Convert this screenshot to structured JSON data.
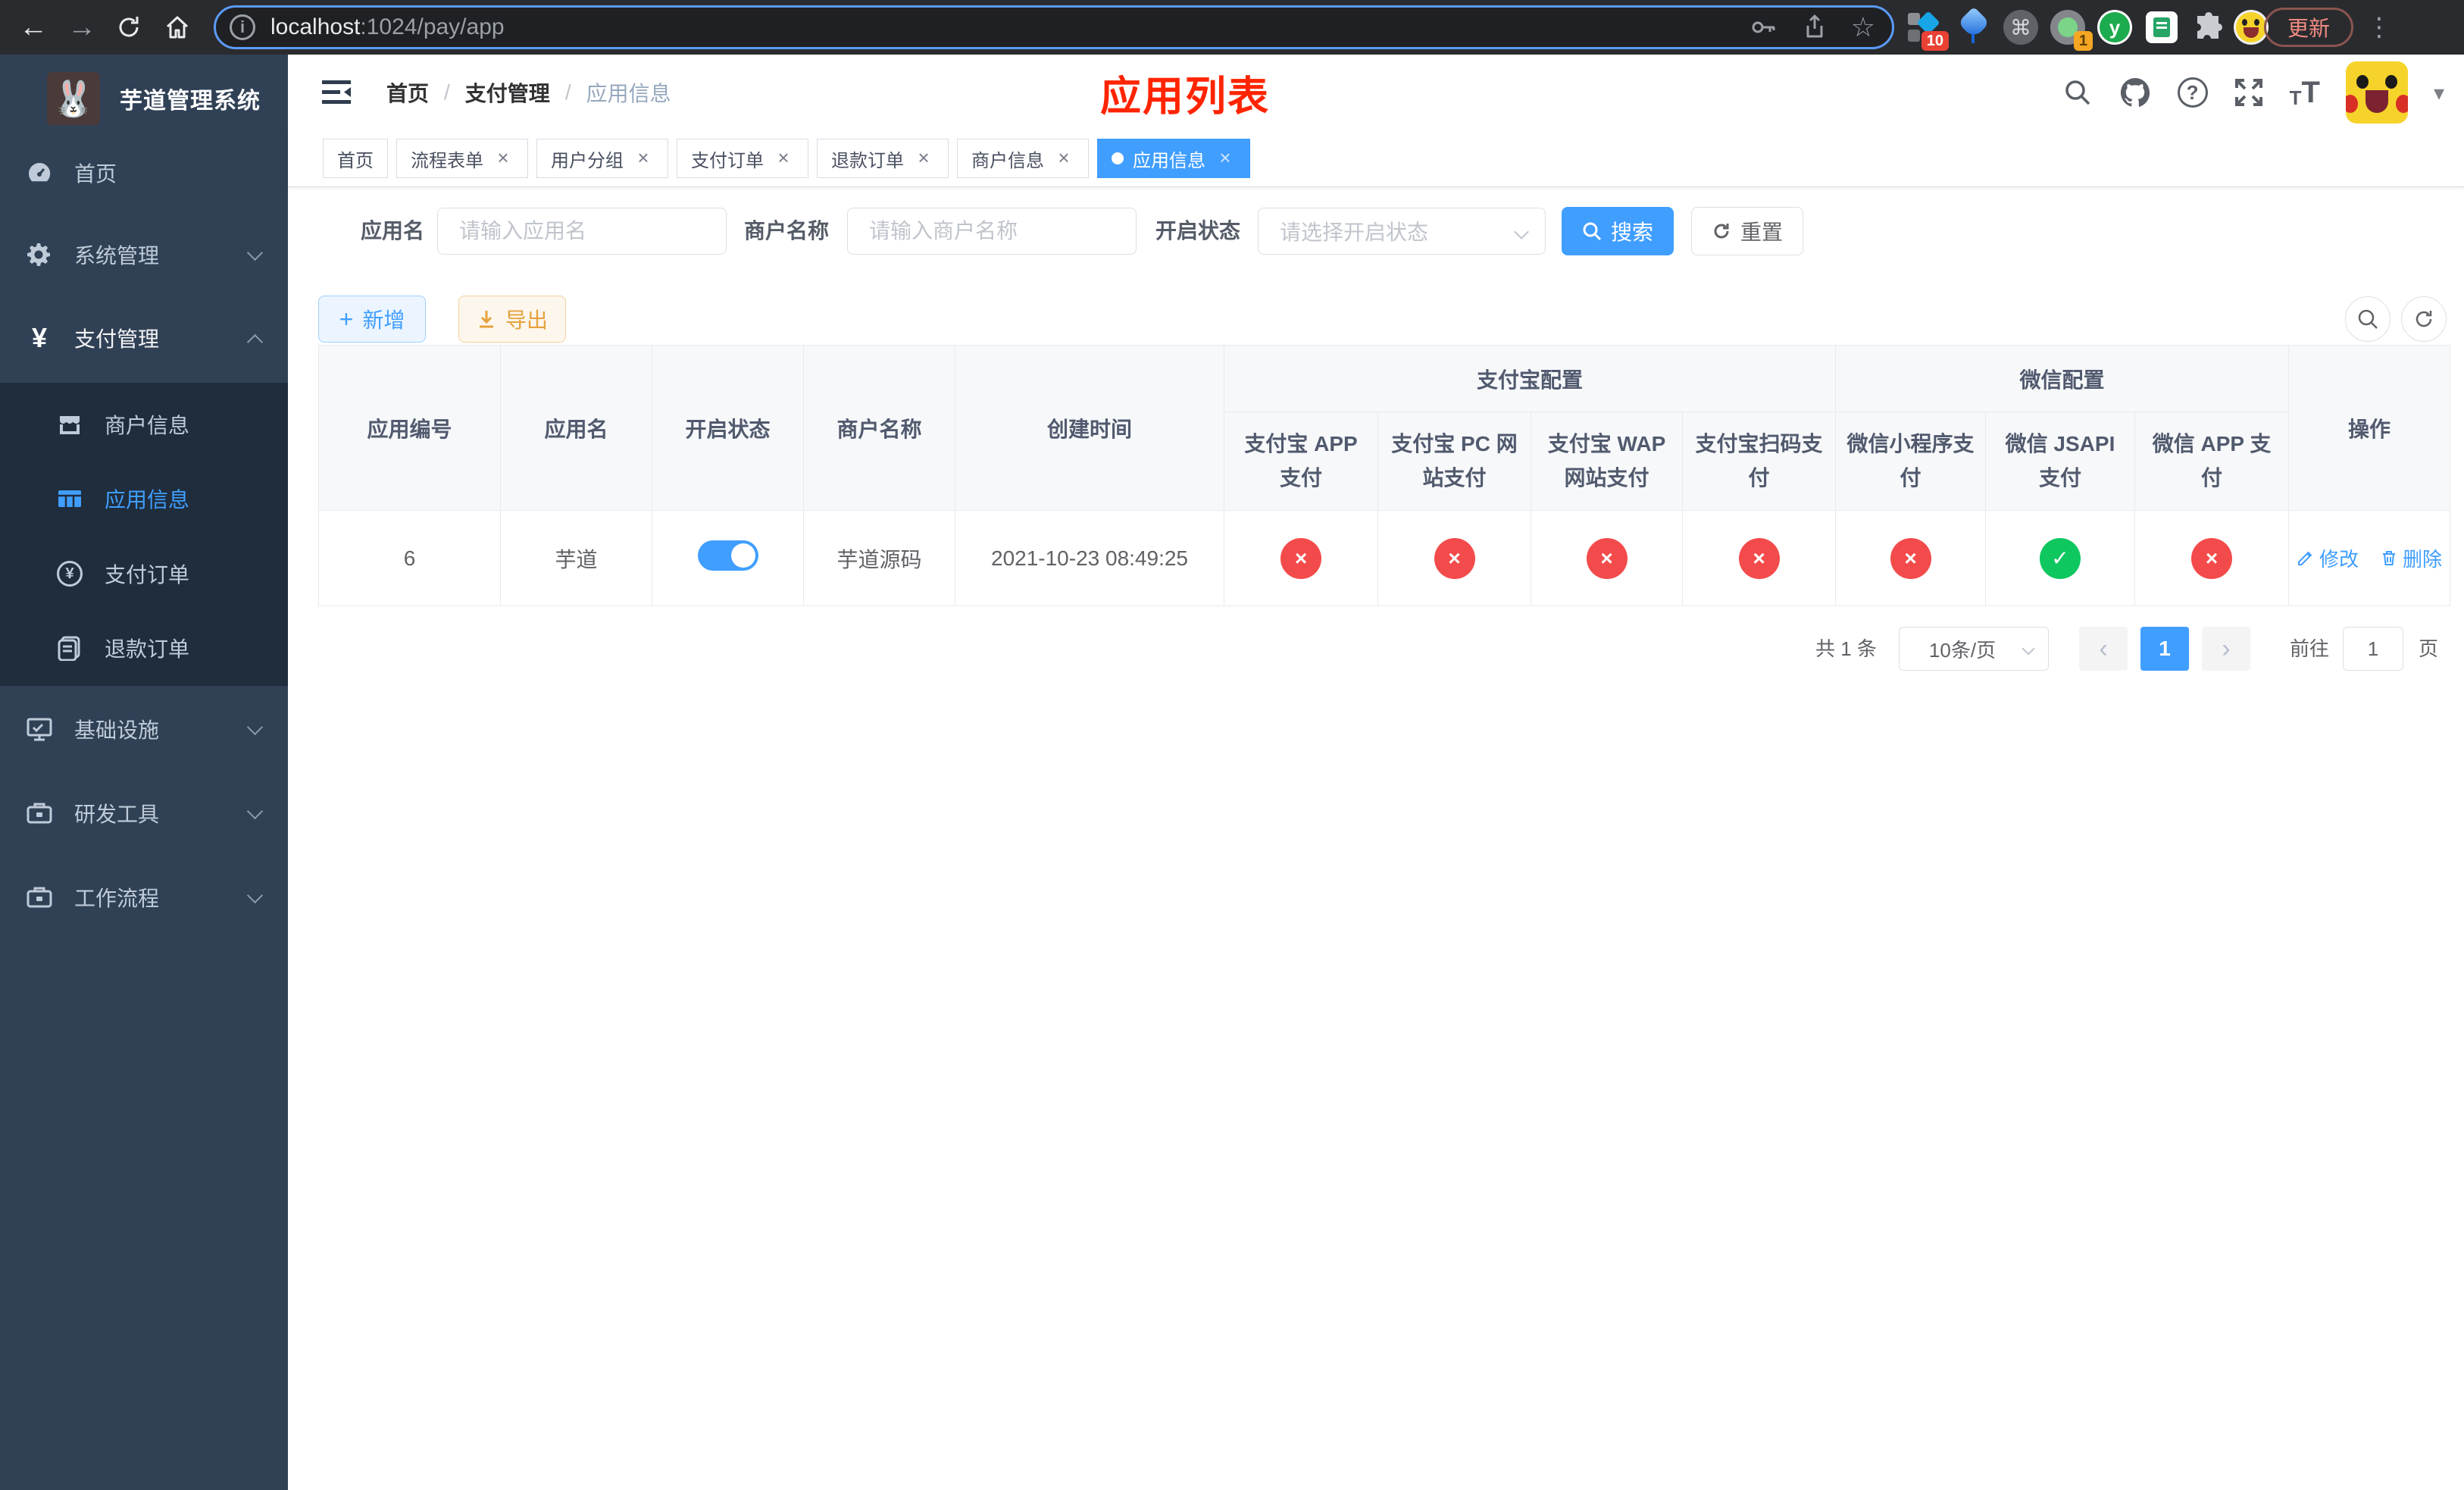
{
  "browser": {
    "url_host": "localhost",
    "url_path": ":1024/pay/app",
    "info_glyph": "i",
    "star_glyph": "☆",
    "back_glyph": "←",
    "forward_glyph": "→",
    "kebab_glyph": "⋮",
    "update_label": "更新",
    "ext_badge_10": "10",
    "ext_badge_1": "1",
    "ext_cmd_glyph": "⌘",
    "ext_y_glyph": "y"
  },
  "sidebar": {
    "title": "芋道管理系统",
    "logo_glyph": "🐰",
    "menu": [
      {
        "label": "首页"
      },
      {
        "label": "系统管理"
      },
      {
        "label": "支付管理"
      },
      {
        "label": "基础设施"
      },
      {
        "label": "研发工具"
      },
      {
        "label": "工作流程"
      }
    ],
    "submenu": [
      {
        "label": "商户信息"
      },
      {
        "label": "应用信息"
      },
      {
        "label": "支付订单"
      },
      {
        "label": "退款订单"
      }
    ],
    "pay_order_icon_glyph": "¥",
    "pay_menu_icon_glyph": "¥"
  },
  "navbar": {
    "breadcrumb": [
      "首页",
      "支付管理",
      "应用信息"
    ],
    "separator": "/",
    "page_title": "应用列表",
    "question_glyph": "?",
    "text_size_small": "T",
    "text_size_big": "T",
    "caret_glyph": "▾"
  },
  "tabs": [
    {
      "label": "首页"
    },
    {
      "label": "流程表单"
    },
    {
      "label": "用户分组"
    },
    {
      "label": "支付订单"
    },
    {
      "label": "退款订单"
    },
    {
      "label": "商户信息"
    },
    {
      "label": "应用信息"
    }
  ],
  "tab_close_glyph": "×",
  "filters": {
    "app_name_label": "应用名",
    "app_name_placeholder": "请输入应用名",
    "merchant_label": "商户名称",
    "merchant_placeholder": "请输入商户名称",
    "status_label": "开启状态",
    "status_placeholder": "请选择开启状态",
    "search_label": "搜索",
    "reset_label": "重置"
  },
  "toolbar": {
    "add_label": "新增",
    "add_glyph": "+",
    "export_label": "导出"
  },
  "table": {
    "headers": {
      "app_id": "应用编号",
      "app_name": "应用名",
      "status": "开启状态",
      "merchant": "商户名称",
      "create_time": "创建时间",
      "alipay_group": "支付宝配置",
      "wechat_group": "微信配置",
      "actions": "操作",
      "sub0": "支付宝 APP 支付",
      "sub1": "支付宝 PC 网站支付",
      "sub2": "支付宝 WAP 网站支付",
      "sub3": "支付宝扫码支付",
      "sub4": "微信小程序支付",
      "sub5": "微信 JSAPI 支付",
      "sub6": "微信 APP 支付"
    },
    "row": {
      "app_id": "6",
      "app_name": "芋道",
      "merchant": "芋道源码",
      "create_time": "2021-10-23 08:49:25",
      "statuses": [
        "×",
        "×",
        "×",
        "×",
        "×",
        "✓",
        "×"
      ],
      "edit_label": "修改",
      "delete_label": "删除"
    }
  },
  "pagination": {
    "total": "共 1 条",
    "page_size": "10条/页",
    "prev_glyph": "‹",
    "next_glyph": "›",
    "page": "1",
    "goto_label": "前往",
    "goto_value": "1",
    "page_unit": "页"
  }
}
